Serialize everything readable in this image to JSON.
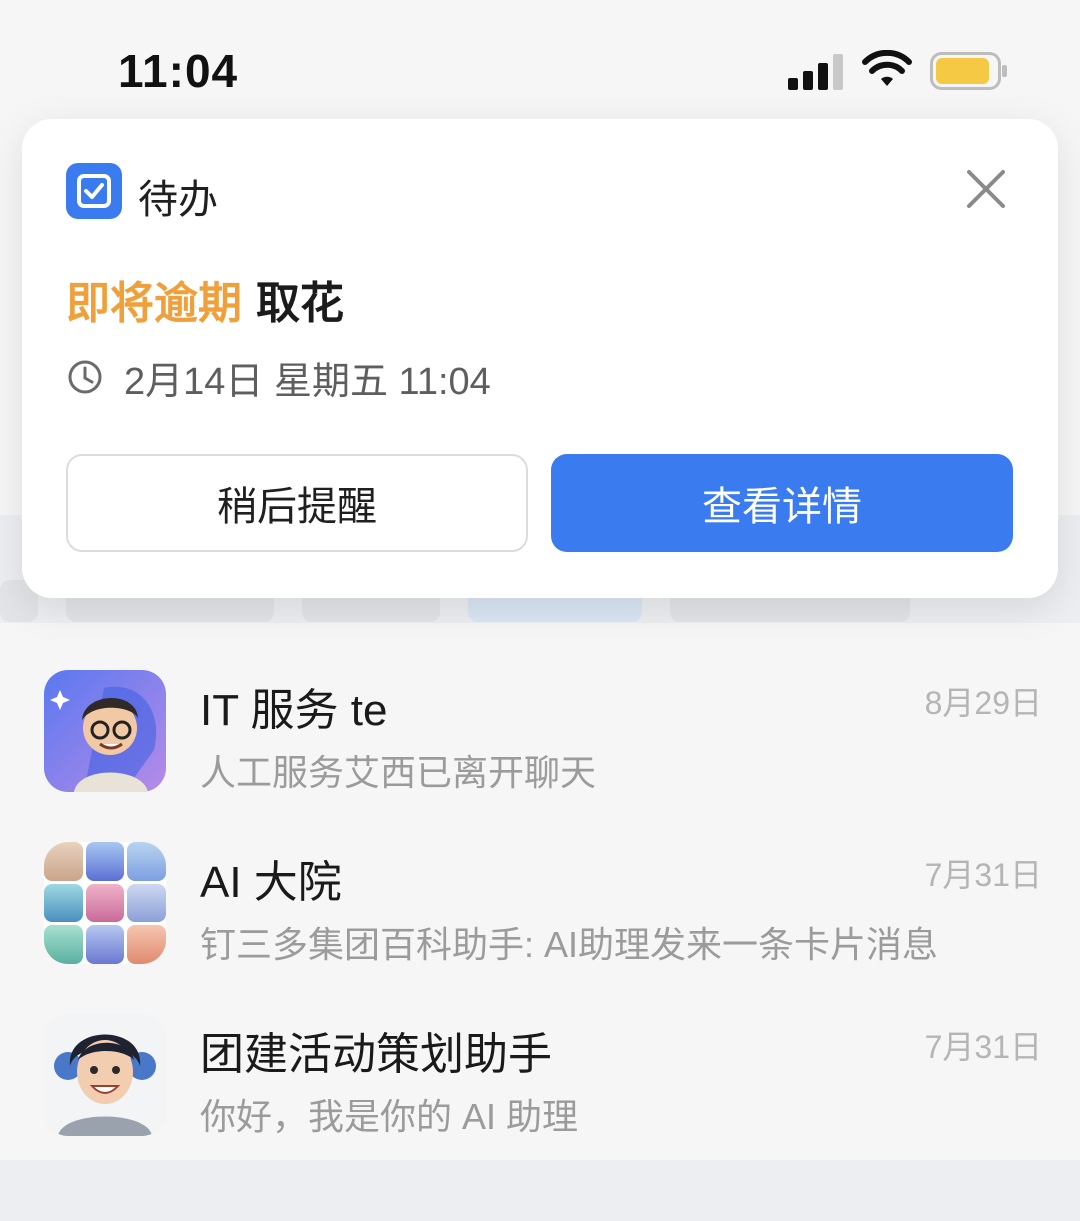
{
  "status_bar": {
    "time": "11:04"
  },
  "notification": {
    "app_name": "待办",
    "status_label": "即将逾期",
    "task_title": "取花",
    "due_time": "2月14日 星期五 11:04",
    "snooze_label": "稍后提醒",
    "detail_label": "查看详情",
    "accent_color": "#3a7bf0",
    "warn_color": "#f0a03a"
  },
  "chats": [
    {
      "title": "IT 服务 te",
      "subtitle": "人工服务艾西已离开聊天",
      "date": "8月29日",
      "avatar_icon": "it-assistant-avatar"
    },
    {
      "title": "AI 大院",
      "subtitle": "钉三多集团百科助手: AI助理发来一条卡片消息",
      "date": "7月31日",
      "avatar_icon": "group-grid-avatar"
    },
    {
      "title": "团建活动策划助手",
      "subtitle": "你好，我是你的 AI 助理",
      "date": "7月31日",
      "avatar_icon": "assistant-avatar"
    }
  ]
}
